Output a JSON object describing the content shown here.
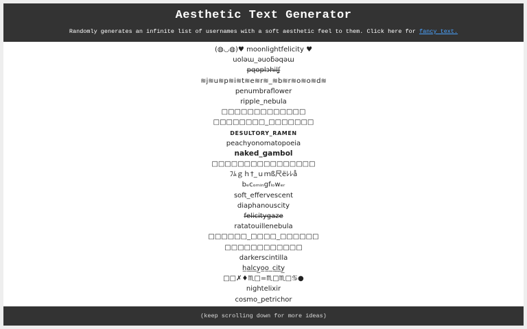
{
  "header": {
    "title": "Aesthetic Text Generator",
    "subtitle_text": "Randomly generates an infinite list of usernames with a soft aesthetic feel to them. Click here for",
    "subtitle_link": "fancy text."
  },
  "usernames": [
    "(◍◡◍)♥ moonlightfelicity ♥",
    "uoləɯ_əuoƃəqəɯ",
    "p̶q̶o̶p̶l̶ɔ̶h̶i̶l̶ʆ̶",
    "≋j≋u≋p≋i≋t≋e≋r≋_≋b≋r≋o≋o≋d≋",
    "penumbraflower",
    "ripple_nebula",
    "□□□□□□□□□□□□□",
    "□□□□□□□□_□□□□□□□",
    "DESULTORY_RAMEN",
    "peachyonomatopoeia",
    "naked_gambol",
    "□□□□□□□□□□□□□□□□",
    "ﾌﾑｇｈ†_ｕｍß尺ёﾚﾚå",
    "bₑcₒₘᵢₙgfₗₒwₑᵣ",
    "soft_effervescent",
    "diaphanouscity",
    "felicitygaze",
    "ratatouillenebula",
    "□□□□□□_□□□□_□□□□□□",
    "□□□□□□□□□□□□",
    "darkerscintilla",
    "h̲a̲l̲c̲y̲o̲o̲_c̲i̲t̲y̲",
    "□□✗♦♏□=♏□♏□♋●",
    "nightelixir",
    "cosmo_petrichor"
  ],
  "footer": {
    "text": "(keep scrolling down for more ideas)"
  }
}
